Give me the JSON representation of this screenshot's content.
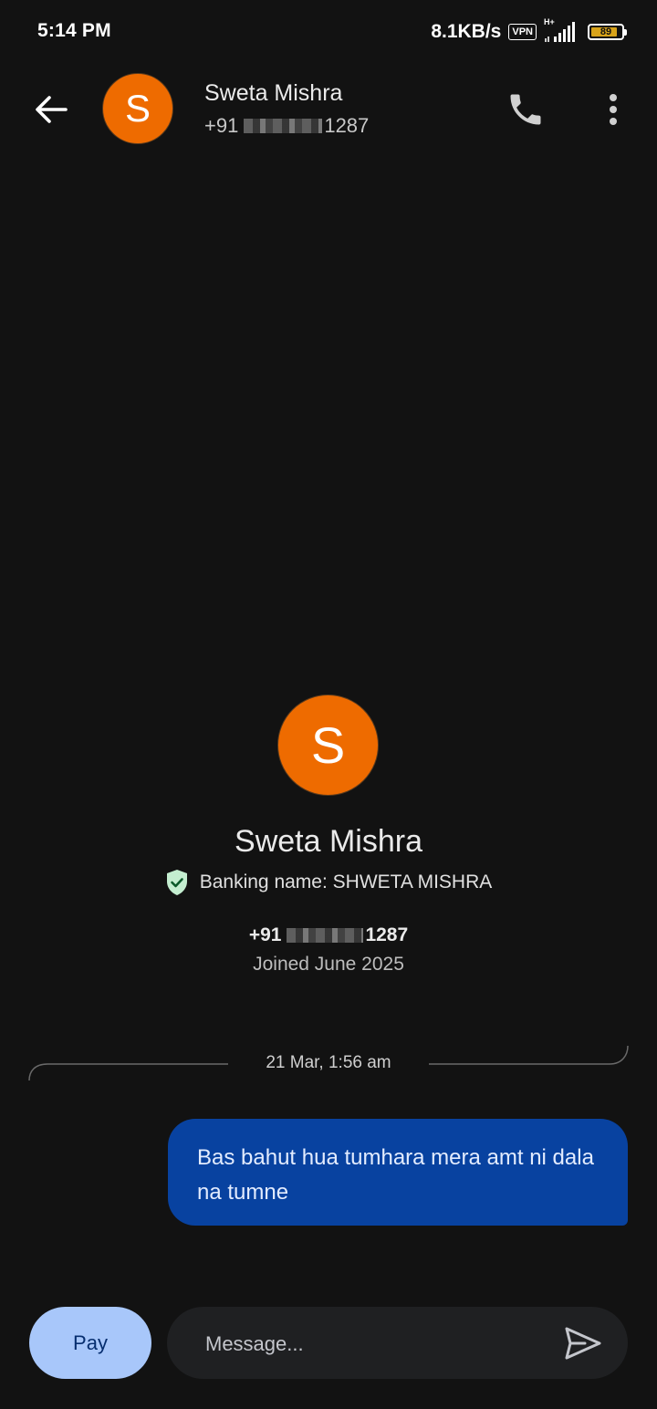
{
  "status_bar": {
    "time": "5:14 PM",
    "net_speed": "8.1KB/s",
    "vpn": "VPN",
    "network_type": "H+",
    "battery": "89",
    "battery_level": 0.89
  },
  "header": {
    "avatar_letter": "S",
    "name": "Sweta Mishra",
    "phone_prefix": "+91",
    "phone_suffix": "1287",
    "icons": {
      "back": "arrow-left-icon",
      "call": "phone-icon",
      "more": "more-vert-icon"
    }
  },
  "profile": {
    "avatar_letter": "S",
    "name": "Sweta Mishra",
    "banking_name": "Banking name: SHWETA MISHRA",
    "phone_prefix": "+91",
    "phone_suffix": "1287",
    "joined": "Joined June 2025",
    "verified_icon": "verified-shield-icon"
  },
  "conversation": {
    "timestamp": "21 Mar, 1:56 am",
    "messages": [
      {
        "direction": "sent",
        "text": "Bas bahut hua tumhara mera amt ni dala na tumne"
      }
    ]
  },
  "composer": {
    "pay_label": "Pay",
    "placeholder": "Message...",
    "send_icon": "send-icon"
  },
  "colors": {
    "background": "#121212",
    "avatar": "#ee6b00",
    "bubble_sent": "#0842a0",
    "pay_button": "#a8c7fa",
    "verified": "#c4eed0"
  }
}
